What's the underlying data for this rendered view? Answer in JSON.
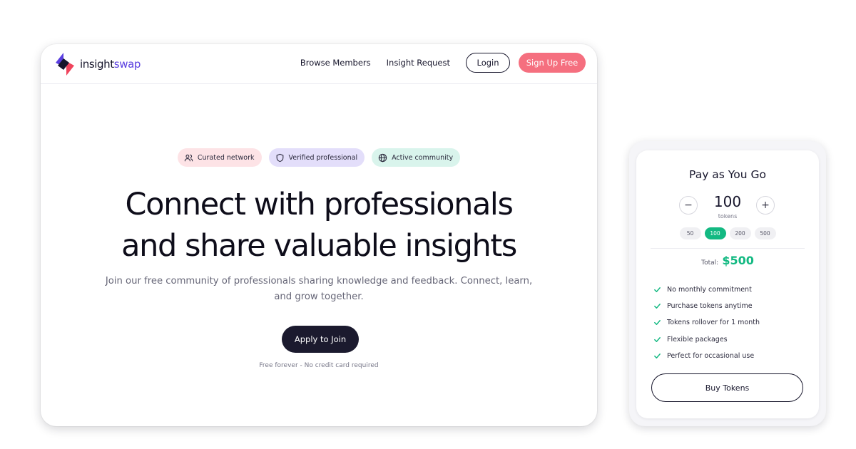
{
  "brand": {
    "name_part1": "insight",
    "name_part2": "swap",
    "logo_icon": "insightswap-logo-icon"
  },
  "nav": {
    "links": [
      "Browse Members",
      "Insight Request"
    ],
    "login_label": "Login",
    "signup_label": "Sign Up Free"
  },
  "badges": [
    {
      "label": "Curated network",
      "icon": "users-icon"
    },
    {
      "label": "Verified professional",
      "icon": "shield-icon"
    },
    {
      "label": "Active community",
      "icon": "globe-icon"
    }
  ],
  "hero": {
    "title_line1": "Connect with professionals",
    "title_line2": "and share valuable insights",
    "subtitle": "Join our free community of professionals sharing knowledge and feedback. Connect, learn, and grow together.",
    "cta_label": "Apply to Join",
    "note": "Free forever - No credit card required"
  },
  "pricing": {
    "title": "Pay as You Go",
    "token_value": "100",
    "token_unit": "tokens",
    "decrement_symbol": "−",
    "increment_symbol": "+",
    "presets": [
      "50",
      "100",
      "200",
      "500"
    ],
    "selected_preset": "100",
    "total_label": "Total:",
    "total_value": "$500",
    "features": [
      "No monthly commitment",
      "Purchase tokens anytime",
      "Tokens rollover for 1 month",
      "Flexible packages",
      "Perfect for occasional use"
    ],
    "buy_label": "Buy Tokens"
  },
  "colors": {
    "brand_purple": "#5a3fe0",
    "brand_pink": "#f56f7f",
    "accent_green": "#13b982",
    "dark": "#1b1a2e"
  }
}
